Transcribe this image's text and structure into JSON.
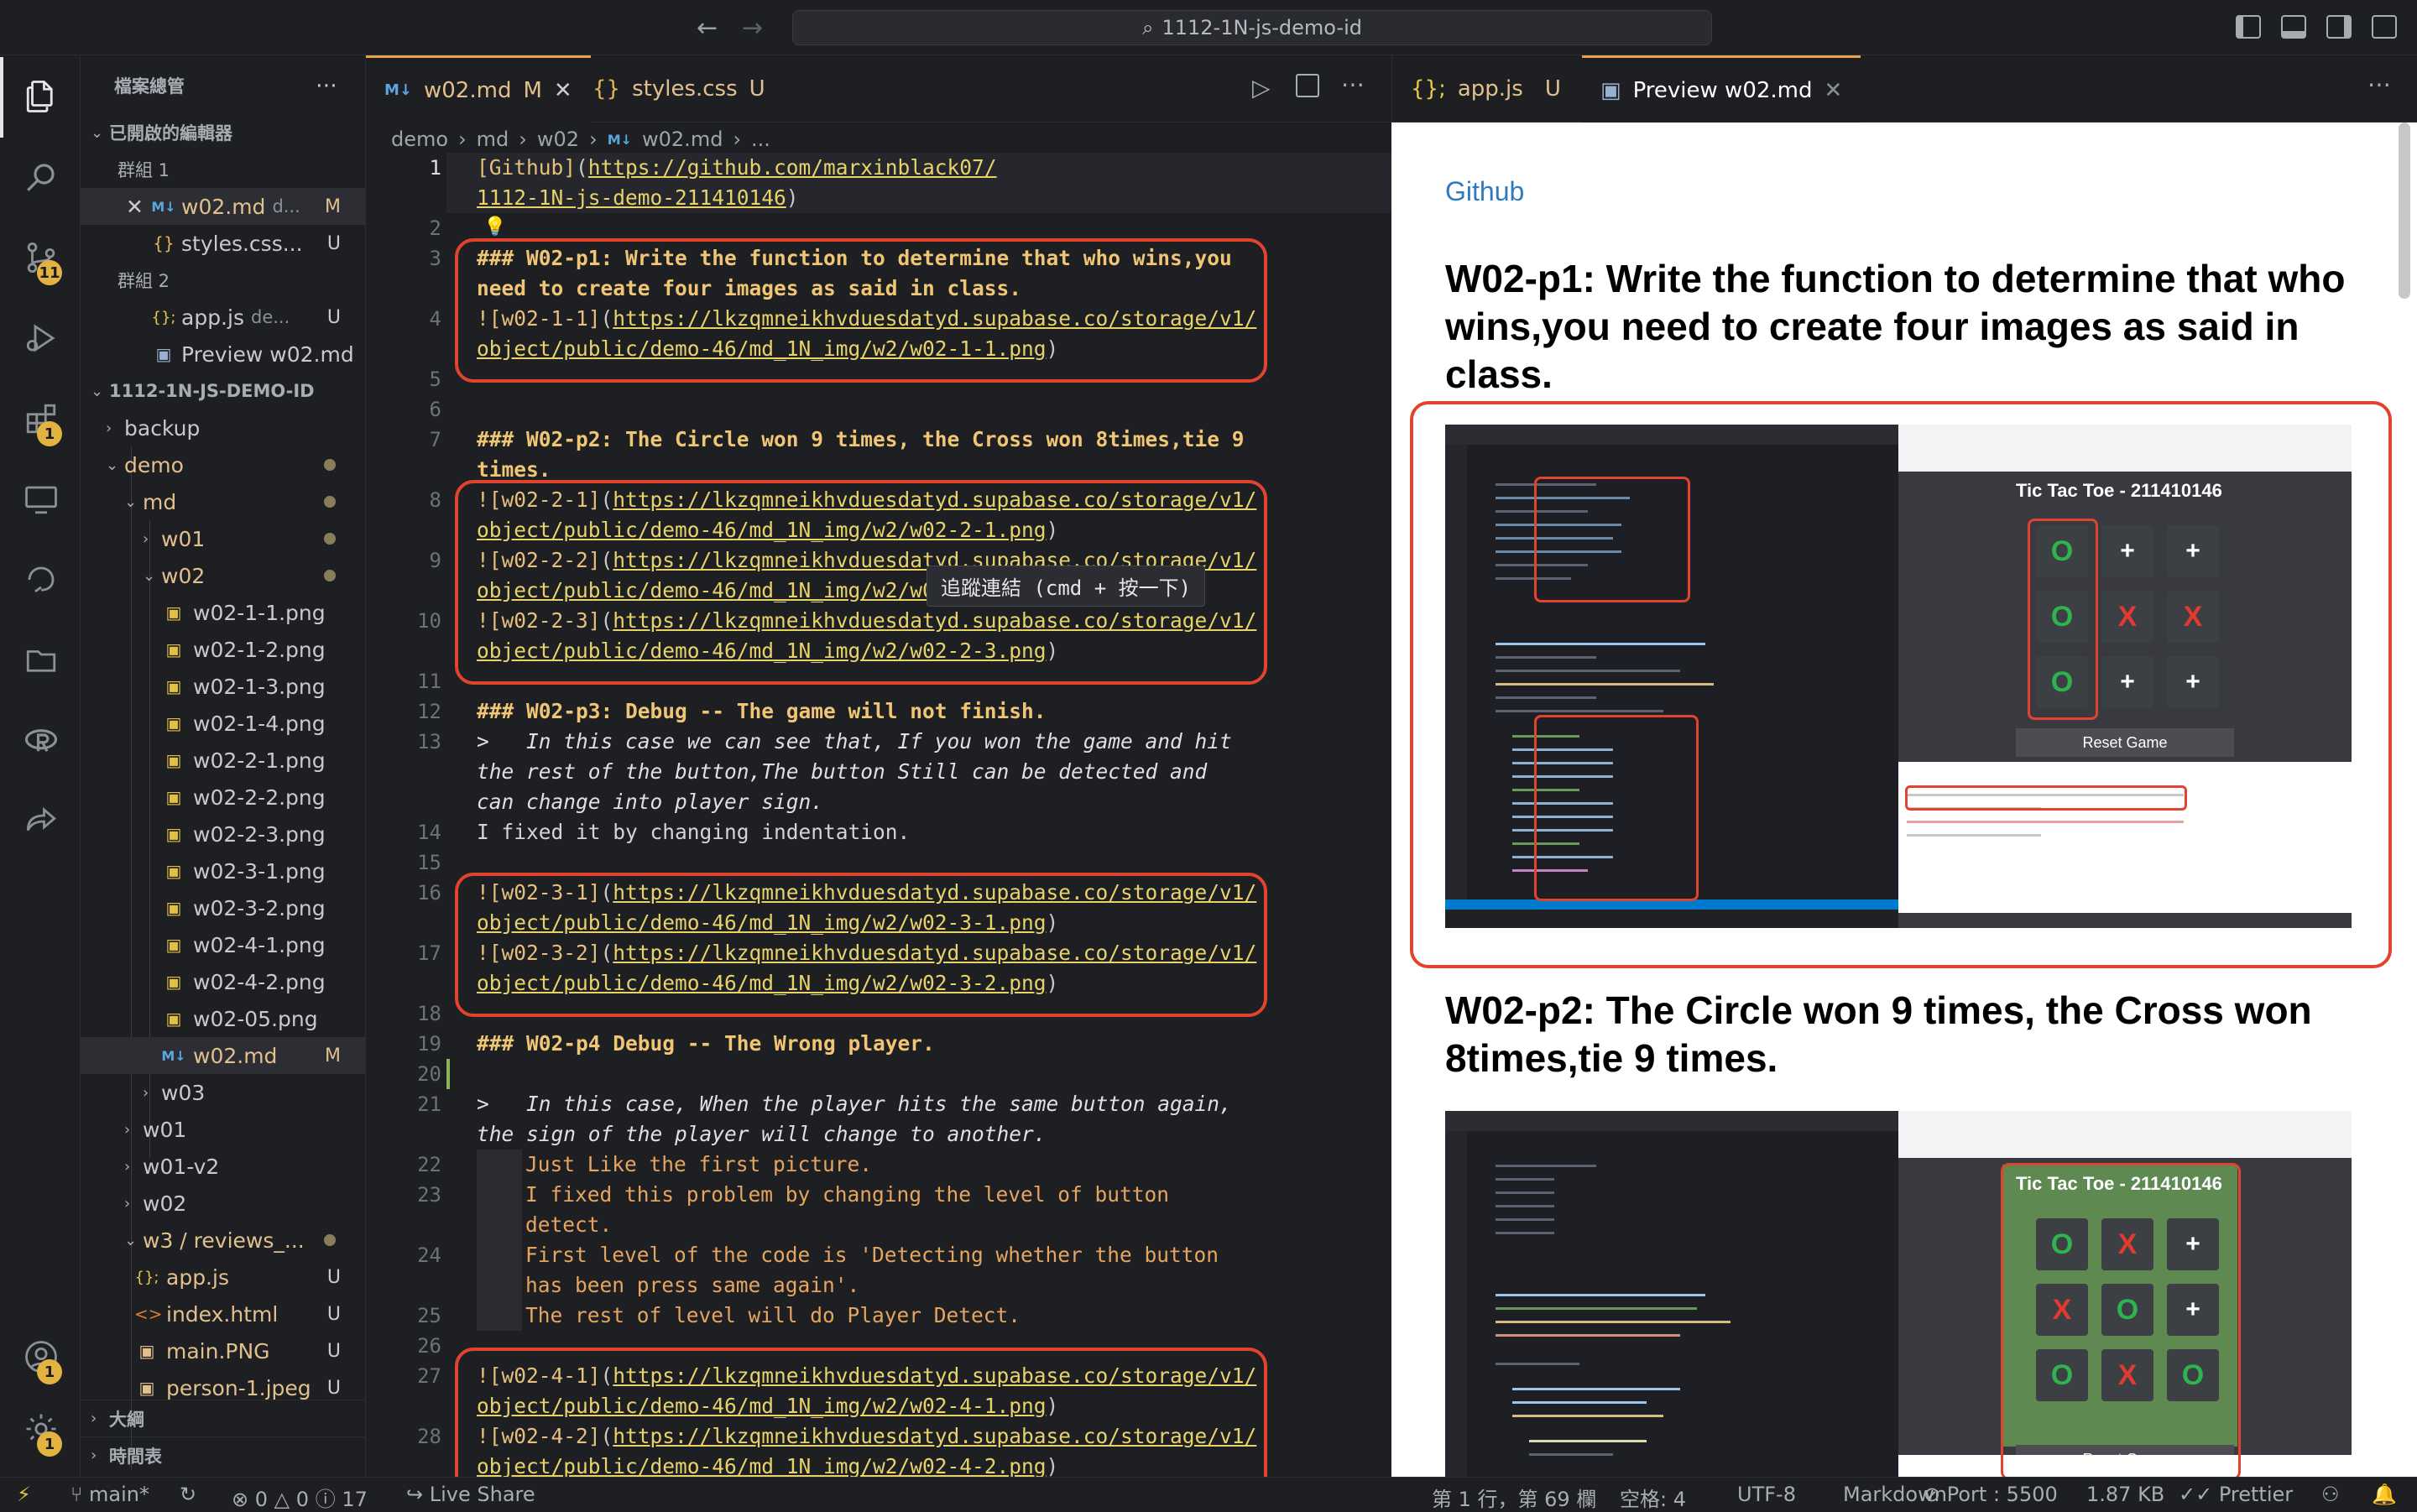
{
  "titlebar": {
    "search": "1112-1N-js-demo-id"
  },
  "activity": {
    "source_control_badge": "11",
    "extensions_badge": "1",
    "accounts_badge": "1",
    "settings_badge": "1"
  },
  "sidebar": {
    "title": "檔案總管",
    "open_editors": "已開啟的編輯器",
    "group1": "群組 1",
    "group2": "群組 2",
    "open_w02md": "w02.md",
    "open_w02md_path": "d...",
    "open_w02md_mark": "M",
    "open_styles": "styles.css...",
    "open_styles_mark": "U",
    "open_appjs": "app.js",
    "open_appjs_path": "de...",
    "open_appjs_mark": "U",
    "open_preview": "Preview w02.md",
    "project": "1112-1N-JS-DEMO-ID",
    "tree": {
      "backup": "backup",
      "demo": "demo",
      "md": "md",
      "w01": "w01",
      "w02": "w02",
      "files": [
        "w02-1-1.png",
        "w02-1-2.png",
        "w02-1-3.png",
        "w02-1-4.png",
        "w02-2-1.png",
        "w02-2-2.png",
        "w02-2-3.png",
        "w02-3-1.png",
        "w02-3-2.png",
        "w02-4-1.png",
        "w02-4-2.png",
        "w02-05.png"
      ],
      "w02md": "w02.md",
      "w02md_mark": "M",
      "w03": "w03",
      "w01b": "w01",
      "w01v2": "w01-v2",
      "w02b": "w02",
      "w3reviews": "w3 / reviews_...",
      "appjs": "app.js",
      "indexhtml": "index.html",
      "mainpng": "main.PNG",
      "person": "person-1.jpeg",
      "u": "U"
    },
    "outline": "大綱",
    "timeline": "時間表"
  },
  "editor": {
    "tab1": "w02.md",
    "tab1_mark": "M",
    "tab2": "styles.css",
    "tab2_mark": "U",
    "breadcrumb": [
      "demo",
      "md",
      "w02",
      "w02.md",
      "..."
    ],
    "tooltip": "追蹤連結 (cmd + 按一下)",
    "lines": {
      "l1a": "[Github]",
      "l1b": "(",
      "l1c": "https://github.com/marxinblack07/",
      "l1d": "1112-1N-js-demo-211410146",
      "l1e": ")",
      "l3a": "### W02-p1: Write the function to determine that who wins,you",
      "l3b": "need to create four images as said in class.",
      "l4a": "![w02-1-1]",
      "l4b": "(",
      "l4c": "https://lkzqmneikhvduesdatyd.supabase.co/storage/v1/",
      "l4d": "object/public/demo-46/md_1N_img/w2/w02-1-1.png",
      "l7a": "### W02-p2: The Circle won 9 times, the Cross won 8times,tie 9",
      "l7b": "times.",
      "l8a": "![w02-2-1]",
      "l8d": "object/public/demo-46/md_1N_img/w2/w02-2-1.png",
      "l9a": "![w02-2-2]",
      "l9d": "object/public/demo-46/md_1N_img/w2/w02-2-2.png",
      "l10a": "![w02-2-3]",
      "l10d": "object/public/demo-46/md_1N_img/w2/w02-2-3.png",
      "l12": "### W02-p3: Debug -- The game will not finish.",
      "l13a": ">   In this case we can see that, If you won the game and hit",
      "l13b": "the rest of the button,The button Still can be detected and",
      "l13c": "can change into player sign.",
      "l14": "I fixed it by changing indentation.",
      "l16a": "![w02-3-1]",
      "l16d": "object/public/demo-46/md_1N_img/w2/w02-3-1.png",
      "l17a": "![w02-3-2]",
      "l17d": "object/public/demo-46/md_1N_img/w2/w02-3-2.png",
      "l19": "### W02-p4 Debug -- The Wrong player.",
      "l21a": ">   In this case, When the player hits the same button again,",
      "l21b": "the sign of the player will change to another.",
      "l22": "Just Like the first picture.",
      "l23a": "I fixed this problem by changing the level of button",
      "l23b": "detect.",
      "l24a": "First level of the code is 'Detecting whether the button",
      "l24b": "has been press same again'.",
      "l25": "The rest of level will do Player Detect.",
      "l27a": "![w02-4-1]",
      "l27d": "object/public/demo-46/md_1N_img/w2/w02-4-1.png",
      "l28a": "![w02-4-2]",
      "l28d": "object/public/demo-46/md_1N_img/w2/w02-4-2.png"
    },
    "gutter": [
      "1",
      "2",
      "3",
      "4",
      "5",
      "6",
      "7",
      "8",
      "9",
      "10",
      "11",
      "12",
      "13",
      "14",
      "15",
      "16",
      "17",
      "18",
      "19",
      "20",
      "21",
      "22",
      "23",
      "24",
      "25",
      "26",
      "27",
      "28"
    ]
  },
  "preview": {
    "tab1": "app.js",
    "tab1_mark": "U",
    "tab2": "Preview w02.md",
    "github": "Github",
    "h_p1": "W02-p1: Write the function to determine that who wins,you need to create four images as said in class.",
    "h_p2": "W02-p2: The Circle won 9 times, the Cross won 8times,tie 9 times.",
    "game_title": "Tic Tac Toe - 211410146",
    "reset": "Reset Game",
    "board1": [
      "O",
      "+",
      "+",
      "O",
      "X",
      "X",
      "O",
      "+",
      "+"
    ],
    "board2": [
      "O",
      "X",
      "+",
      "X",
      "O",
      "+",
      "O",
      "X",
      "O"
    ]
  },
  "status": {
    "branch": "main*",
    "errors": "0",
    "warnings": "0",
    "infos": "17",
    "live_share": "Live Share",
    "position": "第 1 行，第 69 欄",
    "spaces": "空格: 4",
    "encoding": "UTF-8",
    "language": "Markdown",
    "port": "Port : 5500",
    "size": "1.87 KB",
    "prettier": "Prettier"
  },
  "colors": {
    "accent_orange": "#e6a34a",
    "annotation_red": "#e0442f",
    "link_yellow": "#e8d36b",
    "heading_yellow": "#f0c674",
    "preview_link": "#2f7abf"
  }
}
